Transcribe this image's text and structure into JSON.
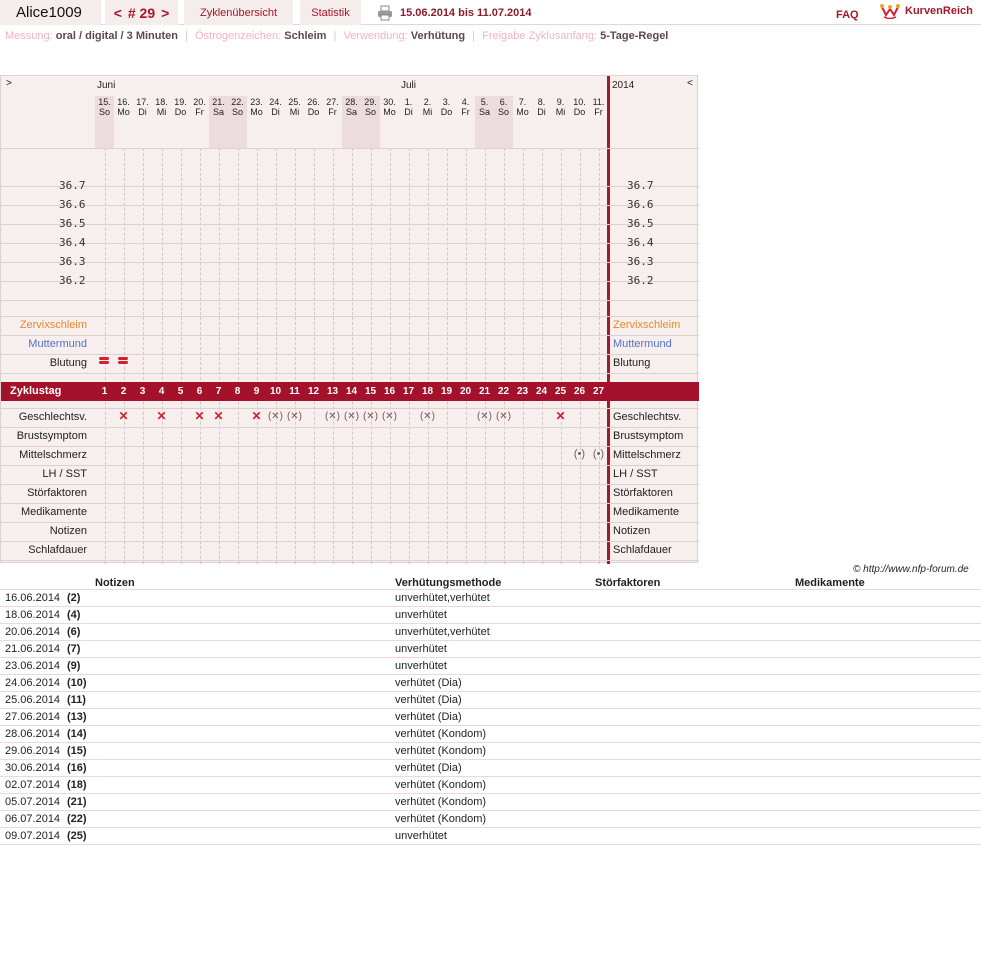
{
  "topbar": {
    "username": "Alice1009",
    "cycle_prev": "<",
    "cycle_label": "# 29",
    "cycle_next": ">",
    "tab_overview": "Zyklenübersicht",
    "tab_stats": "Statistik",
    "print_icon": "printer-icon",
    "date_range": "15.06.2014 bis 11.07.2014",
    "faq": "FAQ",
    "brand": "KurvenReich",
    "brand_icon": "crown-logo-icon"
  },
  "settings": {
    "measure_label": "Messung:",
    "measure_value": "oral / digital / 3 Minuten",
    "estrogen_label": "Östrogenzeichen:",
    "estrogen_value": "Schleim",
    "usage_label": "Verwendung:",
    "usage_value": "Verhütung",
    "release_label": "Freigabe Zyklusanfang:",
    "release_value": "5-Tage-Regel"
  },
  "chart": {
    "nav_left": ">",
    "nav_right": "<",
    "year": "2014",
    "months": [
      "Juni",
      "Juli"
    ],
    "days": [
      {
        "d": "15.",
        "w": "So",
        "we": true
      },
      {
        "d": "16.",
        "w": "Mo",
        "we": false
      },
      {
        "d": "17.",
        "w": "Di",
        "we": false
      },
      {
        "d": "18.",
        "w": "Mi",
        "we": false
      },
      {
        "d": "19.",
        "w": "Do",
        "we": false
      },
      {
        "d": "20.",
        "w": "Fr",
        "we": false
      },
      {
        "d": "21.",
        "w": "Sa",
        "we": true
      },
      {
        "d": "22.",
        "w": "So",
        "we": true
      },
      {
        "d": "23.",
        "w": "Mo",
        "we": false
      },
      {
        "d": "24.",
        "w": "Di",
        "we": false
      },
      {
        "d": "25.",
        "w": "Mi",
        "we": false
      },
      {
        "d": "26.",
        "w": "Do",
        "we": false
      },
      {
        "d": "27.",
        "w": "Fr",
        "we": false
      },
      {
        "d": "28.",
        "w": "Sa",
        "we": true
      },
      {
        "d": "29.",
        "w": "So",
        "we": true
      },
      {
        "d": "30.",
        "w": "Mo",
        "we": false
      },
      {
        "d": "1.",
        "w": "Di",
        "we": false
      },
      {
        "d": "2.",
        "w": "Mi",
        "we": false
      },
      {
        "d": "3.",
        "w": "Do",
        "we": false
      },
      {
        "d": "4.",
        "w": "Fr",
        "we": false
      },
      {
        "d": "5.",
        "w": "Sa",
        "we": true
      },
      {
        "d": "6.",
        "w": "So",
        "we": true
      },
      {
        "d": "7.",
        "w": "Mo",
        "we": false
      },
      {
        "d": "8.",
        "w": "Di",
        "we": false
      },
      {
        "d": "9.",
        "w": "Mi",
        "we": false
      },
      {
        "d": "10.",
        "w": "Do",
        "we": false
      },
      {
        "d": "11.",
        "w": "Fr",
        "we": false
      }
    ],
    "temps": [
      "36.7",
      "36.6",
      "36.5",
      "36.4",
      "36.3",
      "36.2"
    ],
    "rows_top": [
      "Zervixschleim",
      "Muttermund",
      "Blutung"
    ],
    "row_colors": {
      "Zervixschleim": "#e8892a",
      "Muttermund": "#5571c9",
      "Blutung": "#222222"
    },
    "zyklustag_label": "Zyklustag",
    "cycle_days": [
      "1",
      "2",
      "3",
      "4",
      "5",
      "6",
      "7",
      "8",
      "9",
      "10",
      "11",
      "12",
      "13",
      "14",
      "15",
      "16",
      "17",
      "18",
      "19",
      "20",
      "21",
      "22",
      "23",
      "24",
      "25",
      "26",
      "27"
    ],
    "rows_bottom": [
      "Geschlechtsv.",
      "Brustsymptom",
      "Mittelschmerz",
      "LH / SST",
      "Störfaktoren",
      "Medikamente",
      "Notizen",
      "Schlafdauer"
    ],
    "bleeding_days": [
      1,
      2
    ],
    "intercourse": [
      {
        "day": 2,
        "type": "x"
      },
      {
        "day": 4,
        "type": "x"
      },
      {
        "day": 6,
        "type": "x"
      },
      {
        "day": 7,
        "type": "x"
      },
      {
        "day": 9,
        "type": "x"
      },
      {
        "day": 10,
        "type": "p"
      },
      {
        "day": 11,
        "type": "p"
      },
      {
        "day": 13,
        "type": "p"
      },
      {
        "day": 14,
        "type": "p"
      },
      {
        "day": 15,
        "type": "p"
      },
      {
        "day": 16,
        "type": "p"
      },
      {
        "day": 18,
        "type": "p"
      },
      {
        "day": 21,
        "type": "p"
      },
      {
        "day": 22,
        "type": "p"
      },
      {
        "day": 25,
        "type": "x"
      }
    ],
    "mittelschmerz_days": [
      26,
      27
    ],
    "copyright": "© http://www.nfp-forum.de"
  },
  "table": {
    "headers": {
      "notes": "Notizen",
      "method": "Verhütungsmethode",
      "disturb": "Störfaktoren",
      "meds": "Medikamente"
    },
    "rows": [
      {
        "date": "16.06.2014",
        "day": "(2)",
        "method": "unverhütet,verhütet"
      },
      {
        "date": "18.06.2014",
        "day": "(4)",
        "method": "unverhütet"
      },
      {
        "date": "20.06.2014",
        "day": "(6)",
        "method": "unverhütet,verhütet"
      },
      {
        "date": "21.06.2014",
        "day": "(7)",
        "method": "unverhütet"
      },
      {
        "date": "23.06.2014",
        "day": "(9)",
        "method": "unverhütet"
      },
      {
        "date": "24.06.2014",
        "day": "(10)",
        "method": "verhütet (Dia)"
      },
      {
        "date": "25.06.2014",
        "day": "(11)",
        "method": "verhütet (Dia)"
      },
      {
        "date": "27.06.2014",
        "day": "(13)",
        "method": "verhütet (Dia)"
      },
      {
        "date": "28.06.2014",
        "day": "(14)",
        "method": "verhütet (Kondom)"
      },
      {
        "date": "29.06.2014",
        "day": "(15)",
        "method": "verhütet (Kondom)"
      },
      {
        "date": "30.06.2014",
        "day": "(16)",
        "method": "verhütet (Dia)"
      },
      {
        "date": "02.07.2014",
        "day": "(18)",
        "method": "verhütet (Kondom)"
      },
      {
        "date": "05.07.2014",
        "day": "(21)",
        "method": "verhütet (Kondom)"
      },
      {
        "date": "06.07.2014",
        "day": "(22)",
        "method": "verhütet (Kondom)"
      },
      {
        "date": "09.07.2014",
        "day": "(25)",
        "method": "unverhütet"
      }
    ]
  }
}
